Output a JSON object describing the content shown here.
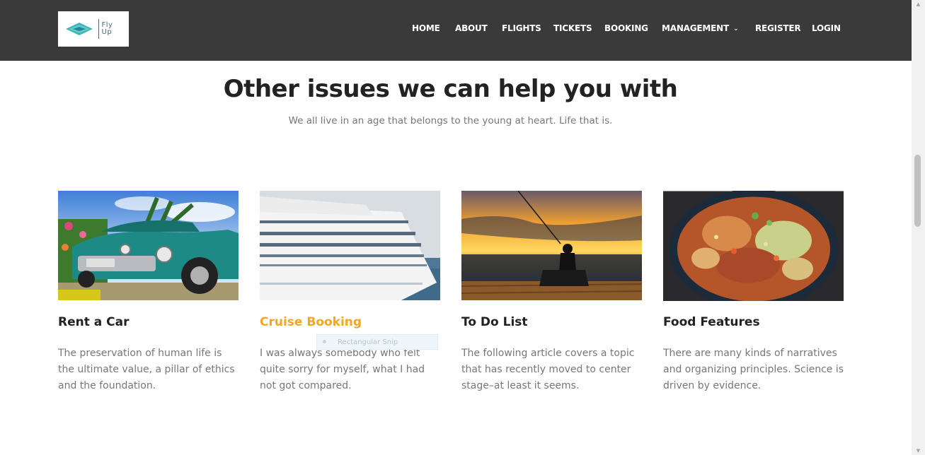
{
  "header": {
    "logo_text": "Fly Up",
    "nav": [
      {
        "label": "HOME"
      },
      {
        "label": "ABOUT"
      },
      {
        "label": "FLIGHTS"
      },
      {
        "label": "TICKETS"
      },
      {
        "label": "BOOKING"
      },
      {
        "label": "MANAGEMENT",
        "has_dropdown": true
      },
      {
        "label": "REGISTER"
      },
      {
        "label": "LOGIN"
      }
    ]
  },
  "section": {
    "title": "Other issues we can help you with",
    "subtitle": "We all live in an age that belongs to the young at heart. Life that is."
  },
  "cards": [
    {
      "title": "Rent a Car",
      "text": "The preservation of human life is the ultimate value, a pillar of ethics and the foundation.",
      "image": "vintage-car"
    },
    {
      "title": "Cruise Booking",
      "text": "I was always somebody who felt quite sorry for myself, what I had not got compared.",
      "image": "cruise-ship",
      "active": true
    },
    {
      "title": "To Do List",
      "text": "The following article covers a topic that has recently moved to center stage–at least it seems.",
      "image": "fishing-sunset"
    },
    {
      "title": "Food Features",
      "text": "There are many kinds of narratives and organizing principles. Science is driven by evidence.",
      "image": "food-bowl"
    }
  ],
  "overlay": {
    "snip_label": "Rectangular Snip"
  },
  "colors": {
    "header_bg": "#3a3a3a",
    "accent": "#f5a623",
    "text": "#222222",
    "muted": "#777777"
  }
}
